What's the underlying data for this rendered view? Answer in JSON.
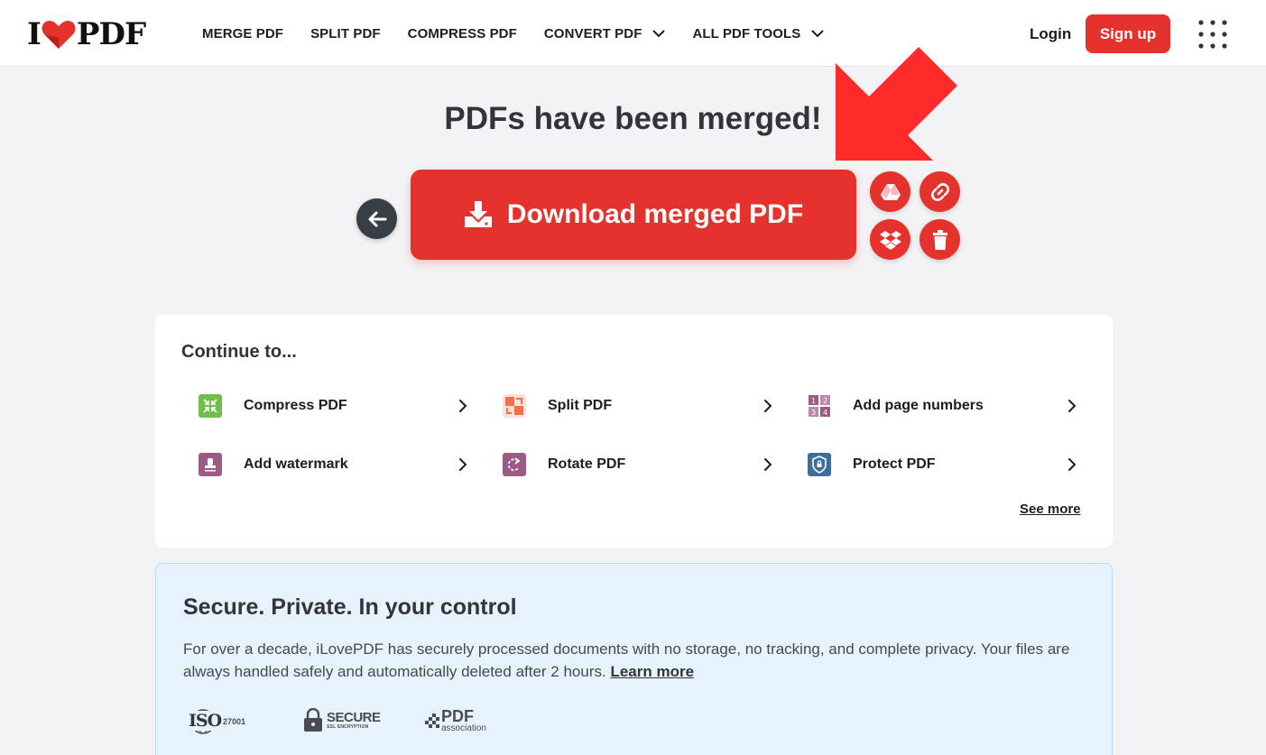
{
  "header": {
    "logo_left": "I",
    "logo_right": "PDF",
    "nav": [
      {
        "label": "MERGE PDF",
        "dropdown": false
      },
      {
        "label": "SPLIT PDF",
        "dropdown": false
      },
      {
        "label": "COMPRESS PDF",
        "dropdown": false
      },
      {
        "label": "CONVERT PDF",
        "dropdown": true
      },
      {
        "label": "ALL PDF TOOLS",
        "dropdown": true
      }
    ],
    "login": "Login",
    "signup": "Sign up"
  },
  "result": {
    "title": "PDFs have been merged!",
    "download_label": "Download merged PDF"
  },
  "continue": {
    "title": "Continue to...",
    "tools": [
      {
        "label": "Compress PDF",
        "icon": "compress-icon",
        "color": "#6fbf4a"
      },
      {
        "label": "Split PDF",
        "icon": "split-icon",
        "color": "#f0704a"
      },
      {
        "label": "Add page numbers",
        "icon": "page-numbers-icon",
        "color": "#9b5b86"
      },
      {
        "label": "Add watermark",
        "icon": "watermark-icon",
        "color": "#9b5b86"
      },
      {
        "label": "Rotate PDF",
        "icon": "rotate-icon",
        "color": "#9b5b86"
      },
      {
        "label": "Protect PDF",
        "icon": "shield-icon",
        "color": "#3d6f9c"
      }
    ],
    "see_more": "See more"
  },
  "secure": {
    "title": "Secure. Private. In your control",
    "text": "For over a decade, iLovePDF has securely processed documents with no storage, no tracking, and complete privacy. Your files are always handled safely and automatically deleted after 2 hours.",
    "learn_more": "Learn more",
    "badges": {
      "iso": "ISO",
      "iso_num": "27001",
      "secure": "SECURE",
      "secure_sub": "SSL ENCRYPTION",
      "pdfa": "PDF",
      "pdfa_sub": "association"
    }
  },
  "colors": {
    "brand_red": "#e5322d",
    "dark_button": "#383e45"
  }
}
